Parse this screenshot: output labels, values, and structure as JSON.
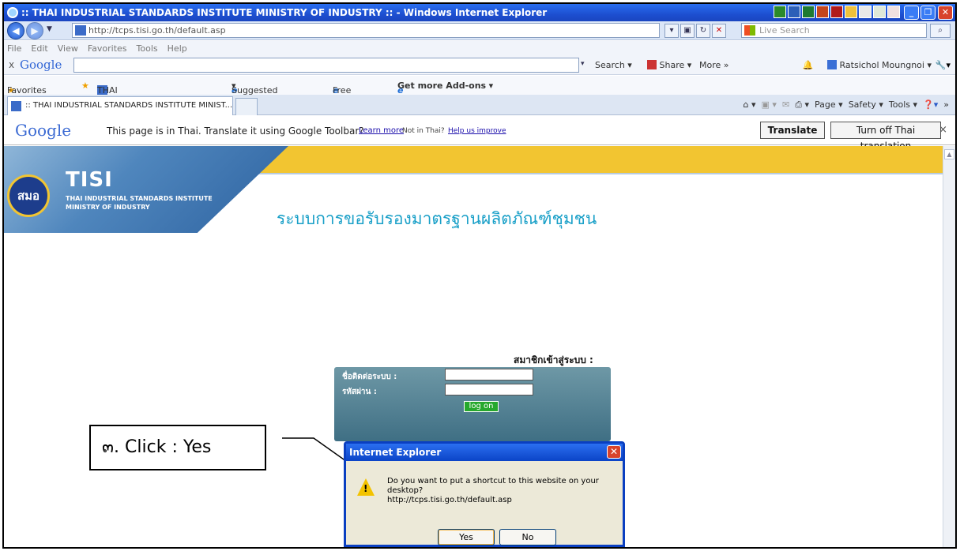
{
  "window": {
    "title": ":: THAI INDUSTRIAL STANDARDS INSTITUTE MINISTRY OF INDUSTRY :: - Windows Internet Explorer",
    "minimize": "_",
    "maximize": "❐",
    "close": "✕"
  },
  "address": {
    "url": "http://tcps.tisi.go.th/default.asp",
    "live_search_placeholder": "Live Search"
  },
  "menu": [
    "File",
    "Edit",
    "View",
    "Favorites",
    "Tools",
    "Help"
  ],
  "google_toolbar": {
    "close": "x",
    "logo": "Google",
    "search": "Search",
    "share": "Share",
    "more": "More »",
    "user": "Ratsichol Moungnoi"
  },
  "favorites": {
    "label": "Favorites",
    "items": [
      "THAI INDUSTRIAL STANDA...",
      "Suggested Sites",
      "Free Hotmail",
      "Get more Add-ons"
    ]
  },
  "tab": {
    "title": ":: THAI INDUSTRIAL STANDARDS INSTITUTE MINIST..."
  },
  "commandbar": {
    "page": "Page",
    "safety": "Safety",
    "tools": "Tools"
  },
  "translate": {
    "logo": "Google",
    "message": "This page is in Thai. Translate it using Google Toolbar?",
    "learn_more": "Learn more",
    "not_thai": "Not in Thai?",
    "help": "Help us improve",
    "translate_btn": "Translate",
    "turn_off_btn": "Turn off Thai translation",
    "close": "×"
  },
  "banner": {
    "logo_text": "สมอ",
    "brand": "TISI",
    "institute": "THAI INDUSTRIAL STANDARDS INSTITUTE",
    "ministry": "MINISTRY OF INDUSTRY",
    "thai_title": "ระบบการขอรับรองมาตรฐานผลิตภัณฑ์ชุมชน"
  },
  "login": {
    "heading": "สมาชิกเข้าสู่ระบบ :",
    "username_label": "ชื่อติดต่อระบบ :",
    "password_label": "รหัสผ่าน :",
    "logon_btn": "log on"
  },
  "callout": {
    "text": "๓. Click : Yes"
  },
  "dialog": {
    "title": "Internet Explorer",
    "message_line1": "Do you want to put a shortcut to this website on your desktop?",
    "message_line2": "http://tcps.tisi.go.th/default.asp",
    "yes": "Yes",
    "no": "No"
  },
  "colors": {
    "titlebar": "#1d4fd0",
    "banner_yellow": "#f2c531",
    "thai_title": "#1aa0c8",
    "login_box": "#3f6f84",
    "logon_button": "#26a82d"
  }
}
